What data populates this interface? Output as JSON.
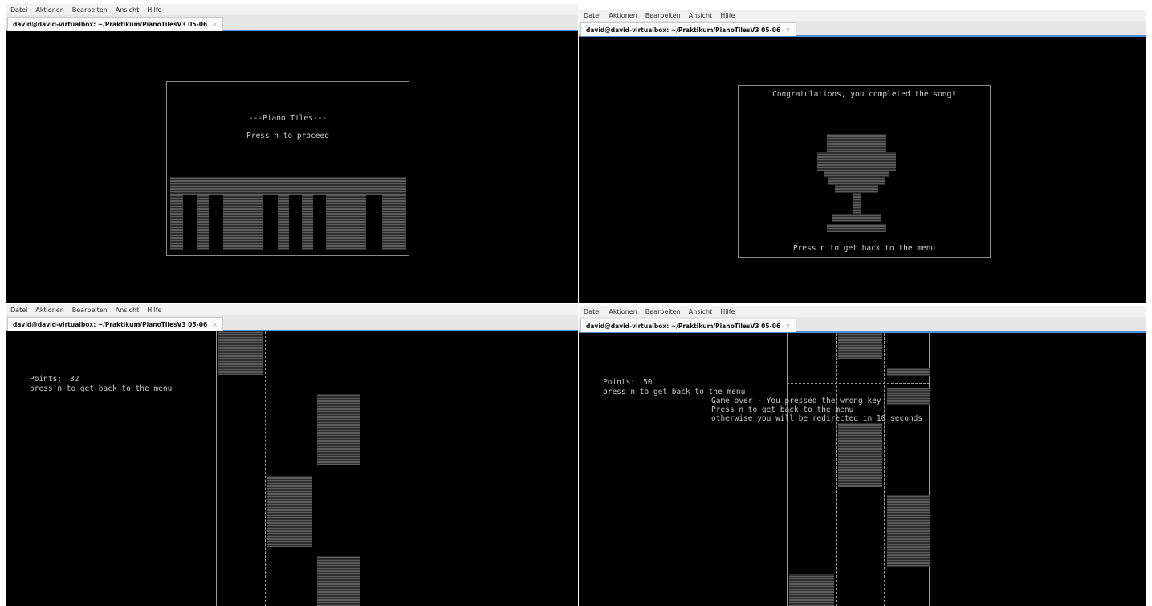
{
  "menu": [
    "Datei",
    "Aktionen",
    "Bearbeiten",
    "Ansicht",
    "Hilfe"
  ],
  "tab_title": "david@david-virtualbox: ~/Praktikum/PianoTilesV3 05-06",
  "tab_close": "×",
  "panels": {
    "title_screen": {
      "heading": "---Piano Tiles---",
      "prompt": "Press n to proceed"
    },
    "win_screen": {
      "heading": "Congratulations, you completed the song!",
      "prompt": "Press n to get back to the menu"
    },
    "game_screen": {
      "points_label": "Points:",
      "points_value": "32",
      "hint": "press n to get back to the menu"
    },
    "gameover_screen": {
      "points_label": "Points:",
      "points_value": "50",
      "hint": "press n to get back to the menu",
      "message_1": "Game over - You pressed the wrong key",
      "message_2": "Press n to get back to the menu",
      "message_3": "otherwise you will be redirected in 10 seconds"
    }
  }
}
